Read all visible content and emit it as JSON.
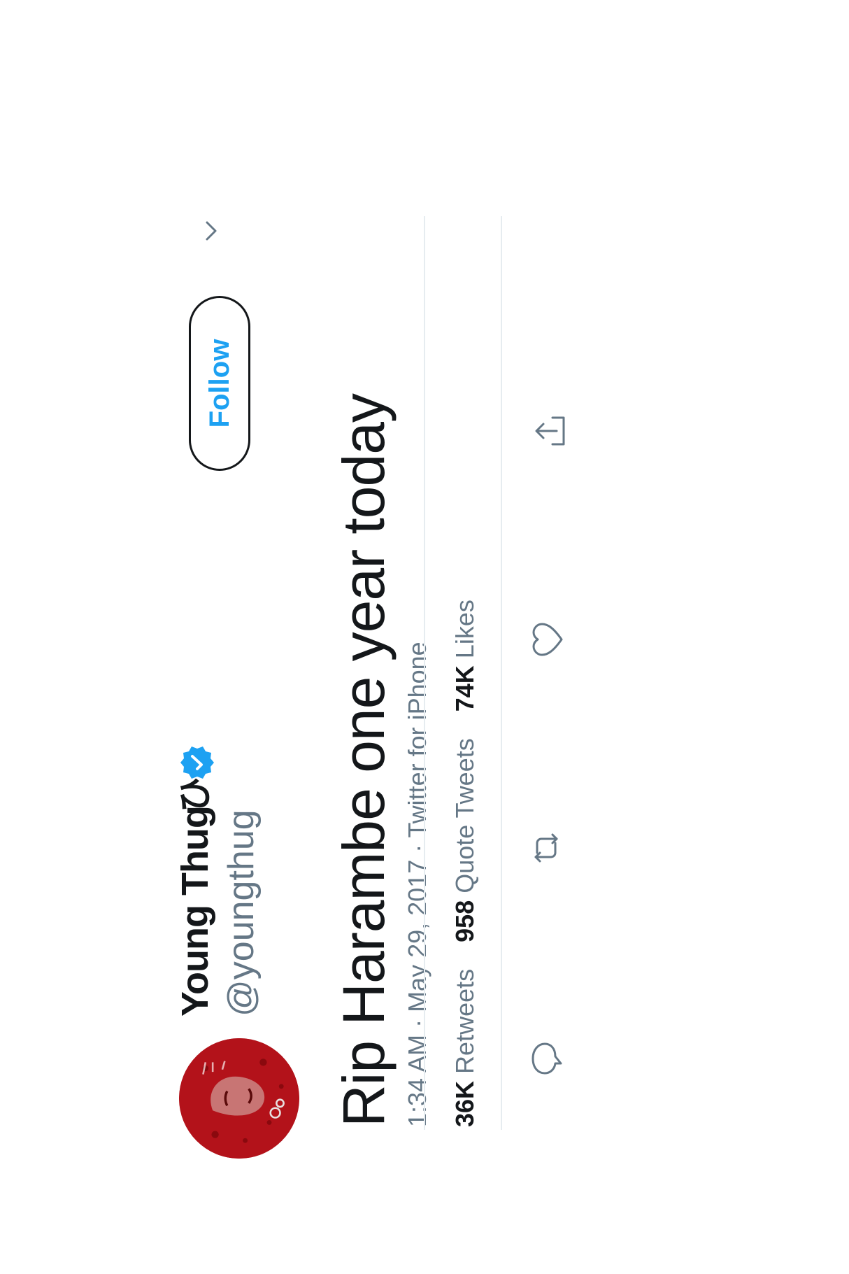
{
  "tweet": {
    "author": {
      "display_name": "Young Thug",
      "name_suffix": "ひ",
      "handle": "@youngthug",
      "verified": true,
      "avatar_icon": "avatar-image"
    },
    "follow_label": "Follow",
    "text": "Rip Harambe one year today",
    "timestamp": "1:34 AM · May 29, 2017 · Twitter for iPhone",
    "stats": {
      "retweets_count": "36K",
      "retweets_label": "Retweets",
      "quotes_count": "958",
      "quotes_label": "Quote Tweets",
      "likes_count": "74K",
      "likes_label": "Likes"
    },
    "actions": [
      "reply-icon",
      "retweet-icon",
      "like-icon",
      "share-icon"
    ]
  },
  "colors": {
    "accent": "#1da1f2",
    "text_primary": "#14171a",
    "text_secondary": "#657786",
    "divider": "#e6ecf0",
    "avatar_red": "#b3121a"
  }
}
